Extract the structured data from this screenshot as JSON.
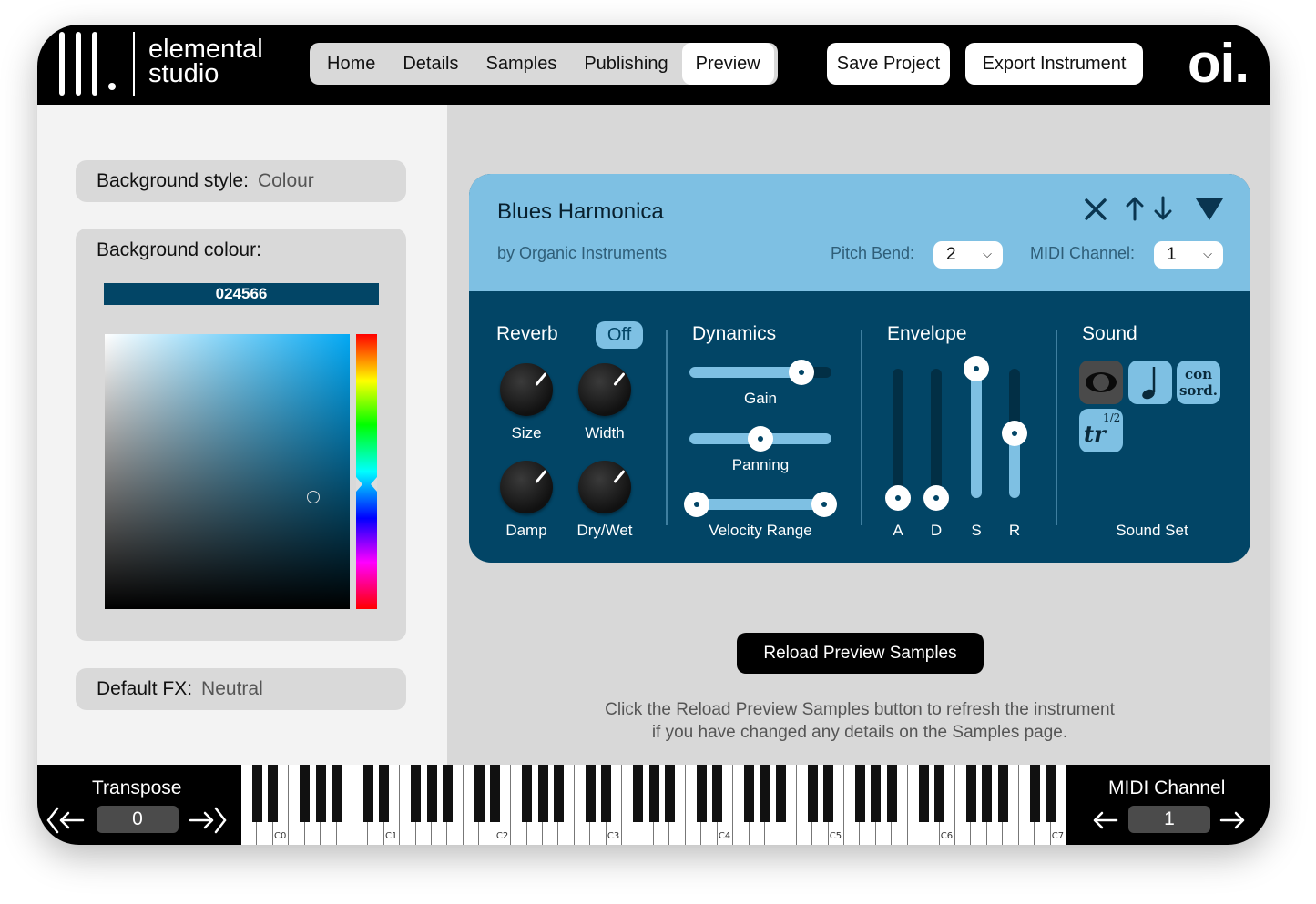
{
  "header": {
    "logo_line1": "elemental",
    "logo_line2": "studio",
    "tabs": [
      {
        "label": "Home",
        "active": false
      },
      {
        "label": "Details",
        "active": false
      },
      {
        "label": "Samples",
        "active": false
      },
      {
        "label": "Publishing",
        "active": false
      },
      {
        "label": "Preview",
        "active": true
      }
    ],
    "save_label": "Save Project",
    "export_label": "Export Instrument",
    "brand": "oi."
  },
  "left_panel": {
    "bg_style_label": "Background style:",
    "bg_style_value": "Colour",
    "bg_colour_label": "Background colour:",
    "bg_colour_hex": "024566",
    "default_fx_label": "Default FX:",
    "default_fx_value": "Neutral"
  },
  "instrument": {
    "title": "Blues Harmonica",
    "subtitle": "by Organic Instruments",
    "pitch_bend_label": "Pitch Bend:",
    "pitch_bend_value": "2",
    "midi_channel_label": "MIDI Channel:",
    "midi_channel_value": "1",
    "icons": [
      "close-icon",
      "move-up-icon",
      "move-down-icon",
      "collapse-triangle-icon"
    ],
    "reverb": {
      "title": "Reverb",
      "toggle": "Off",
      "knobs": [
        "Size",
        "Width",
        "Damp",
        "Dry/Wet"
      ]
    },
    "dynamics": {
      "title": "Dynamics",
      "gain_label": "Gain",
      "gain_value": 0.82,
      "panning_label": "Panning",
      "panning_value": 0.5,
      "velocity_label": "Velocity Range",
      "velocity_low": 0.0,
      "velocity_high": 1.0
    },
    "envelope": {
      "title": "Envelope",
      "labels": [
        "A",
        "D",
        "S",
        "R"
      ],
      "values": [
        0.0,
        0.0,
        1.0,
        0.5
      ]
    },
    "sound": {
      "title": "Sound",
      "set_label": "Sound Set",
      "buttons": [
        "open-sound-icon",
        "note-icon",
        "con sord.",
        "trill-half-icon"
      ],
      "con_line1": "con",
      "con_line2": "sord.",
      "trill_fraction": "1/2",
      "trill_text": "tr"
    }
  },
  "reload_label": "Reload Preview Samples",
  "help_line1": "Click the Reload Preview Samples button to refresh the instrument",
  "help_line2": "if you have changed any details on the Samples page.",
  "bottom": {
    "transpose_label": "Transpose",
    "transpose_value": "0",
    "midi_label": "MIDI Channel",
    "midi_value": "1",
    "octaves": [
      "C0",
      "C1",
      "C2",
      "C3",
      "C4",
      "C5",
      "C6",
      "C7"
    ]
  },
  "colors": {
    "accent_dark": "#024566",
    "accent_light": "#7ec0e3"
  }
}
